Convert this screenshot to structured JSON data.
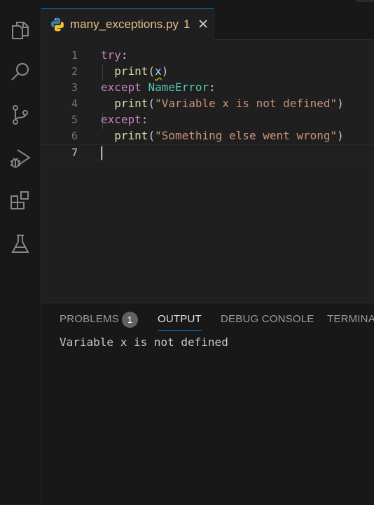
{
  "editor": {
    "tab": {
      "filename": "many_exceptions.py",
      "problem_count": "1"
    },
    "line_numbers": [
      "1",
      "2",
      "3",
      "4",
      "5",
      "6",
      "7"
    ],
    "code": {
      "l1_kw": "try",
      "l1_colon": ":",
      "l2_fn": "print",
      "l2_open": "(",
      "l2_var": "x",
      "l2_close": ")",
      "l3_kw": "except",
      "l3_cls": "NameError",
      "l3_colon": ":",
      "l4_fn": "print",
      "l4_open": "(",
      "l4_str": "\"Variable x is not defined\"",
      "l4_close": ")",
      "l5_kw": "except",
      "l5_colon": ":",
      "l6_fn": "print",
      "l6_open": "(",
      "l6_str": "\"Something else went wrong\"",
      "l6_close": ")"
    }
  },
  "activity_bar": [
    "explorer-icon",
    "search-icon",
    "source-control-icon",
    "run-debug-icon",
    "extensions-icon",
    "testing-icon"
  ],
  "panel": {
    "tabs": {
      "problems": "PROBLEMS",
      "output": "OUTPUT",
      "debug_console": "DEBUG CONSOLE",
      "terminal": "TERMINAL"
    },
    "problems_badge": "1",
    "active_tab": "OUTPUT",
    "output_text": "Variable x is not defined"
  },
  "colors": {
    "accent": "#0078d4",
    "keyword": "#c586c0",
    "class": "#4ec9b0",
    "string": "#ce9178",
    "modified_tab": "#e2c08d"
  }
}
